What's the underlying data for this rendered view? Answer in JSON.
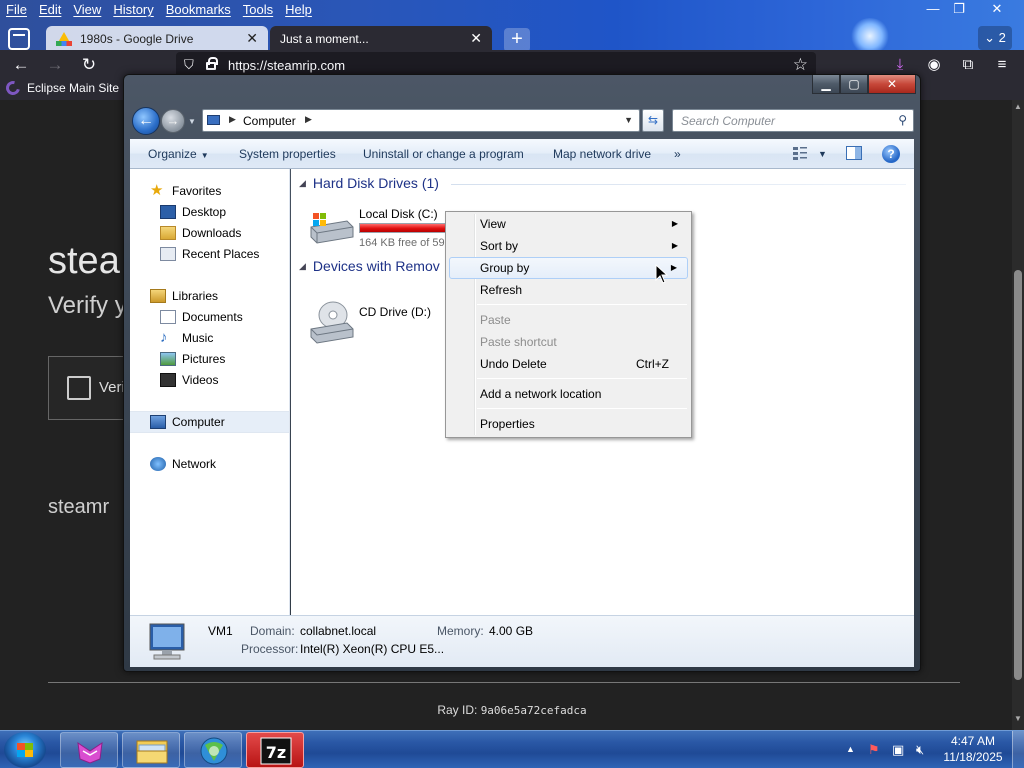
{
  "firefox": {
    "menu": [
      "File",
      "Edit",
      "View",
      "History",
      "Bookmarks",
      "Tools",
      "Help"
    ],
    "window_controls": {
      "minimize": "—",
      "restore": "❐",
      "close": "✕"
    },
    "tabs": [
      {
        "title": "1980s - Google Drive",
        "active": false
      },
      {
        "title": "Just a moment...",
        "active": true
      }
    ],
    "tab_count": "2",
    "url": "https://steamrip.com",
    "bookmark": "Eclipse Main Site"
  },
  "page": {
    "heading": "stea",
    "subheading": "Verify y",
    "checkbox_label": "Veri",
    "site_text": "steamr",
    "ray_label": "Ray ID:",
    "ray_id": "9a06e5a72cefadca"
  },
  "explorer": {
    "address_crumb": "Computer",
    "search_placeholder": "Search Computer",
    "commands": {
      "organize": "Organize",
      "system_properties": "System properties",
      "uninstall": "Uninstall or change a program",
      "map_drive": "Map network drive",
      "more": "»"
    },
    "nav": {
      "favorites": "Favorites",
      "desktop": "Desktop",
      "downloads": "Downloads",
      "recent": "Recent Places",
      "libraries": "Libraries",
      "documents": "Documents",
      "music": "Music",
      "pictures": "Pictures",
      "videos": "Videos",
      "computer": "Computer",
      "network": "Network"
    },
    "groups": {
      "hdd": "Hard Disk Drives (1)",
      "removable": "Devices with Remov"
    },
    "drives": {
      "c_name": "Local Disk (C:)",
      "c_free": "164 KB free of 59",
      "c_used_fraction": 0.99,
      "d_name": "CD Drive (D:)"
    },
    "details": {
      "pc_name": "VM1",
      "domain_label": "Domain:",
      "domain": "collabnet.local",
      "memory_label": "Memory:",
      "memory": "4.00 GB",
      "processor_label": "Processor:",
      "processor": "Intel(R) Xeon(R) CPU E5..."
    }
  },
  "context_menu": {
    "view": "View",
    "sort_by": "Sort by",
    "group_by": "Group by",
    "refresh": "Refresh",
    "paste": "Paste",
    "paste_shortcut": "Paste shortcut",
    "undo_delete": "Undo Delete",
    "undo_shortcut": "Ctrl+Z",
    "add_network": "Add a network location",
    "properties": "Properties"
  },
  "taskbar": {
    "time": "4:47 AM",
    "date": "11/18/2025"
  },
  "colors": {
    "drive_bar_full": "#e01010",
    "group_header": "#1e3287",
    "menu_hover_border": "#aecff7"
  }
}
